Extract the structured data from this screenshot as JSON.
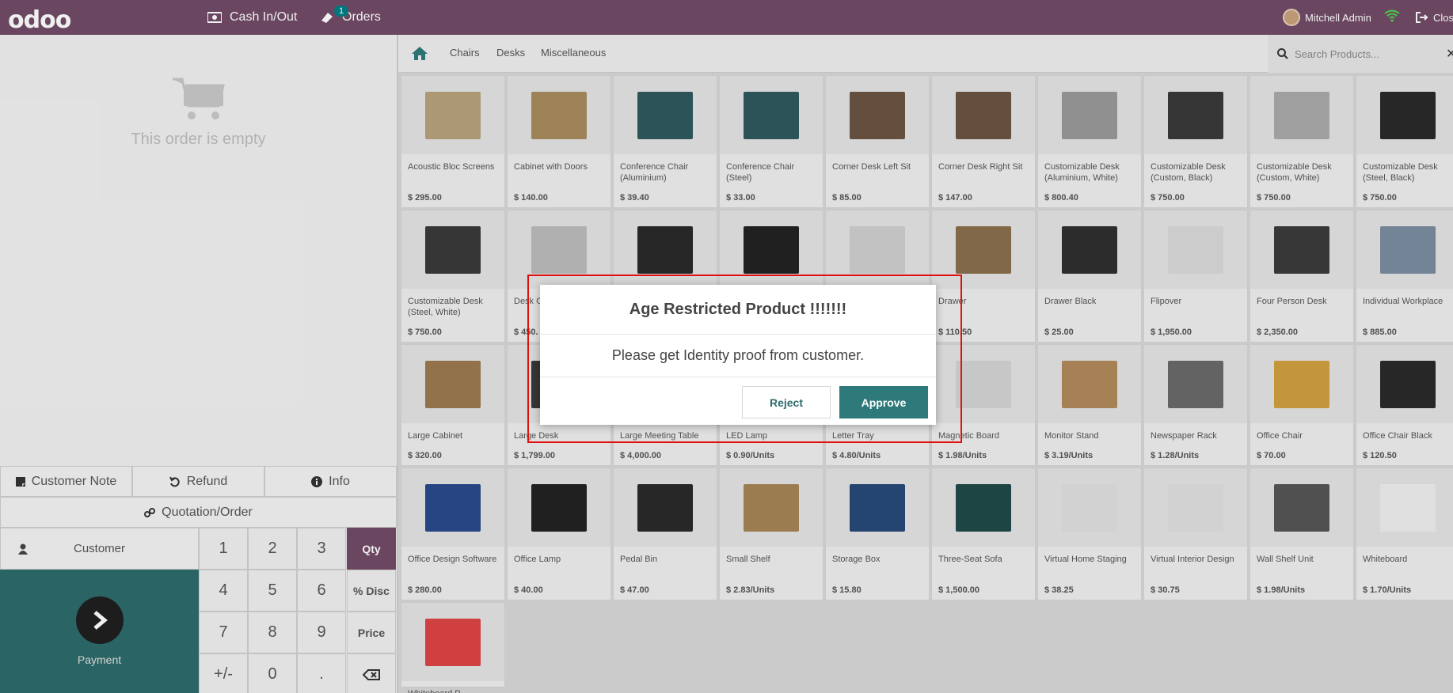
{
  "topbar": {
    "logo": "odoo",
    "cash_label": "Cash In/Out",
    "orders_label": "Orders",
    "orders_badge": "1",
    "user_name": "Mitchell Admin",
    "close_label": "Close"
  },
  "order": {
    "empty_message": "This order is empty"
  },
  "controls": {
    "customer_note": "Customer Note",
    "refund": "Refund",
    "info": "Info",
    "quotation": "Quotation/Order",
    "customer": "Customer",
    "payment": "Payment"
  },
  "numpad": {
    "keys": [
      "1",
      "2",
      "3",
      "4",
      "5",
      "6",
      "7",
      "8",
      "9",
      "+/-",
      "0",
      "."
    ],
    "modes": [
      "Qty",
      "% Disc",
      "Price"
    ],
    "active_mode": "Qty"
  },
  "categories": [
    "Chairs",
    "Desks",
    "Miscellaneous"
  ],
  "search": {
    "placeholder": "Search Products..."
  },
  "products": [
    {
      "name": "Acoustic Bloc Screens",
      "price": "$ 295.00"
    },
    {
      "name": "Cabinet with Doors",
      "price": "$ 140.00"
    },
    {
      "name": "Conference Chair (Aluminium)",
      "price": "$ 39.40"
    },
    {
      "name": "Conference Chair (Steel)",
      "price": "$ 33.00"
    },
    {
      "name": "Corner Desk Left Sit",
      "price": "$ 85.00"
    },
    {
      "name": "Corner Desk Right Sit",
      "price": "$ 147.00"
    },
    {
      "name": "Customizable Desk (Aluminium, White)",
      "price": "$ 800.40"
    },
    {
      "name": "Customizable Desk (Custom, Black)",
      "price": "$ 750.00"
    },
    {
      "name": "Customizable Desk (Custom, White)",
      "price": "$ 750.00"
    },
    {
      "name": "Customizable Desk (Steel, Black)",
      "price": "$ 750.00"
    },
    {
      "name": "Customizable Desk (Steel, White)",
      "price": "$ 750.00"
    },
    {
      "name": "Desk C",
      "price": "$ 450."
    },
    {
      "name": "",
      "price": ""
    },
    {
      "name": "",
      "price": ""
    },
    {
      "name": "",
      "price": ""
    },
    {
      "name": "Drawer",
      "price": "$ 110.50"
    },
    {
      "name": "Drawer Black",
      "price": "$ 25.00"
    },
    {
      "name": "Flipover",
      "price": "$ 1,950.00"
    },
    {
      "name": "Four Person Desk",
      "price": "$ 2,350.00"
    },
    {
      "name": "Individual Workplace",
      "price": "$ 885.00"
    },
    {
      "name": "Large Cabinet",
      "price": "$ 320.00"
    },
    {
      "name": "Large Desk",
      "price": "$ 1,799.00"
    },
    {
      "name": "Large Meeting Table",
      "price": "$ 4,000.00"
    },
    {
      "name": "LED Lamp",
      "price": "$ 0.90/Units"
    },
    {
      "name": "Letter Tray",
      "price": "$ 4.80/Units"
    },
    {
      "name": "Magnetic Board",
      "price": "$ 1.98/Units"
    },
    {
      "name": "Monitor Stand",
      "price": "$ 3.19/Units"
    },
    {
      "name": "Newspaper Rack",
      "price": "$ 1.28/Units"
    },
    {
      "name": "Office Chair",
      "price": "$ 70.00"
    },
    {
      "name": "Office Chair Black",
      "price": "$ 120.50"
    },
    {
      "name": "Office Design Software",
      "price": "$ 280.00"
    },
    {
      "name": "Office Lamp",
      "price": "$ 40.00"
    },
    {
      "name": "Pedal Bin",
      "price": "$ 47.00"
    },
    {
      "name": "Small Shelf",
      "price": "$ 2.83/Units"
    },
    {
      "name": "Storage Box",
      "price": "$ 15.80"
    },
    {
      "name": "Three-Seat Sofa",
      "price": "$ 1,500.00"
    },
    {
      "name": "Virtual Home Staging",
      "price": "$ 38.25"
    },
    {
      "name": "Virtual Interior Design",
      "price": "$ 30.75"
    },
    {
      "name": "Wall Shelf Unit",
      "price": "$ 1.98/Units"
    },
    {
      "name": "Whiteboard",
      "price": "$ 1.70/Units"
    },
    {
      "name": "Whiteboard P",
      "price": ""
    }
  ],
  "dialog": {
    "title": "Age Restricted Product !!!!!!!",
    "body": "Please get Identity proof from customer.",
    "reject": "Reject",
    "approve": "Approve"
  }
}
